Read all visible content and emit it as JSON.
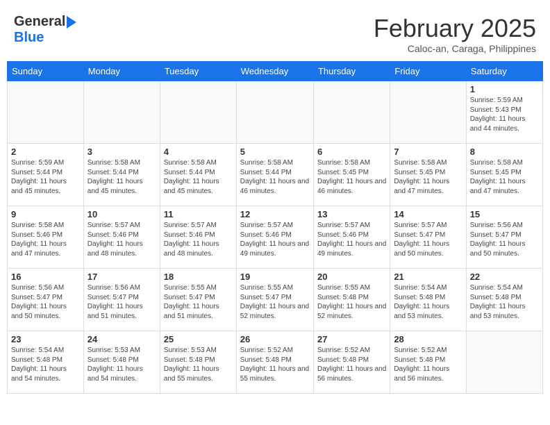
{
  "header": {
    "logo_general": "General",
    "logo_blue": "Blue",
    "month_title": "February 2025",
    "location": "Caloc-an, Caraga, Philippines"
  },
  "days_of_week": [
    "Sunday",
    "Monday",
    "Tuesday",
    "Wednesday",
    "Thursday",
    "Friday",
    "Saturday"
  ],
  "weeks": [
    [
      {
        "day": "",
        "info": ""
      },
      {
        "day": "",
        "info": ""
      },
      {
        "day": "",
        "info": ""
      },
      {
        "day": "",
        "info": ""
      },
      {
        "day": "",
        "info": ""
      },
      {
        "day": "",
        "info": ""
      },
      {
        "day": "1",
        "info": "Sunrise: 5:59 AM\nSunset: 5:43 PM\nDaylight: 11 hours\nand 44 minutes."
      }
    ],
    [
      {
        "day": "2",
        "info": "Sunrise: 5:59 AM\nSunset: 5:44 PM\nDaylight: 11 hours\nand 45 minutes."
      },
      {
        "day": "3",
        "info": "Sunrise: 5:58 AM\nSunset: 5:44 PM\nDaylight: 11 hours\nand 45 minutes."
      },
      {
        "day": "4",
        "info": "Sunrise: 5:58 AM\nSunset: 5:44 PM\nDaylight: 11 hours\nand 45 minutes."
      },
      {
        "day": "5",
        "info": "Sunrise: 5:58 AM\nSunset: 5:44 PM\nDaylight: 11 hours\nand 46 minutes."
      },
      {
        "day": "6",
        "info": "Sunrise: 5:58 AM\nSunset: 5:45 PM\nDaylight: 11 hours\nand 46 minutes."
      },
      {
        "day": "7",
        "info": "Sunrise: 5:58 AM\nSunset: 5:45 PM\nDaylight: 11 hours\nand 47 minutes."
      },
      {
        "day": "8",
        "info": "Sunrise: 5:58 AM\nSunset: 5:45 PM\nDaylight: 11 hours\nand 47 minutes."
      }
    ],
    [
      {
        "day": "9",
        "info": "Sunrise: 5:58 AM\nSunset: 5:46 PM\nDaylight: 11 hours\nand 47 minutes."
      },
      {
        "day": "10",
        "info": "Sunrise: 5:57 AM\nSunset: 5:46 PM\nDaylight: 11 hours\nand 48 minutes."
      },
      {
        "day": "11",
        "info": "Sunrise: 5:57 AM\nSunset: 5:46 PM\nDaylight: 11 hours\nand 48 minutes."
      },
      {
        "day": "12",
        "info": "Sunrise: 5:57 AM\nSunset: 5:46 PM\nDaylight: 11 hours\nand 49 minutes."
      },
      {
        "day": "13",
        "info": "Sunrise: 5:57 AM\nSunset: 5:46 PM\nDaylight: 11 hours\nand 49 minutes."
      },
      {
        "day": "14",
        "info": "Sunrise: 5:57 AM\nSunset: 5:47 PM\nDaylight: 11 hours\nand 50 minutes."
      },
      {
        "day": "15",
        "info": "Sunrise: 5:56 AM\nSunset: 5:47 PM\nDaylight: 11 hours\nand 50 minutes."
      }
    ],
    [
      {
        "day": "16",
        "info": "Sunrise: 5:56 AM\nSunset: 5:47 PM\nDaylight: 11 hours\nand 50 minutes."
      },
      {
        "day": "17",
        "info": "Sunrise: 5:56 AM\nSunset: 5:47 PM\nDaylight: 11 hours\nand 51 minutes."
      },
      {
        "day": "18",
        "info": "Sunrise: 5:55 AM\nSunset: 5:47 PM\nDaylight: 11 hours\nand 51 minutes."
      },
      {
        "day": "19",
        "info": "Sunrise: 5:55 AM\nSunset: 5:47 PM\nDaylight: 11 hours\nand 52 minutes."
      },
      {
        "day": "20",
        "info": "Sunrise: 5:55 AM\nSunset: 5:48 PM\nDaylight: 11 hours\nand 52 minutes."
      },
      {
        "day": "21",
        "info": "Sunrise: 5:54 AM\nSunset: 5:48 PM\nDaylight: 11 hours\nand 53 minutes."
      },
      {
        "day": "22",
        "info": "Sunrise: 5:54 AM\nSunset: 5:48 PM\nDaylight: 11 hours\nand 53 minutes."
      }
    ],
    [
      {
        "day": "23",
        "info": "Sunrise: 5:54 AM\nSunset: 5:48 PM\nDaylight: 11 hours\nand 54 minutes."
      },
      {
        "day": "24",
        "info": "Sunrise: 5:53 AM\nSunset: 5:48 PM\nDaylight: 11 hours\nand 54 minutes."
      },
      {
        "day": "25",
        "info": "Sunrise: 5:53 AM\nSunset: 5:48 PM\nDaylight: 11 hours\nand 55 minutes."
      },
      {
        "day": "26",
        "info": "Sunrise: 5:52 AM\nSunset: 5:48 PM\nDaylight: 11 hours\nand 55 minutes."
      },
      {
        "day": "27",
        "info": "Sunrise: 5:52 AM\nSunset: 5:48 PM\nDaylight: 11 hours\nand 56 minutes."
      },
      {
        "day": "28",
        "info": "Sunrise: 5:52 AM\nSunset: 5:48 PM\nDaylight: 11 hours\nand 56 minutes."
      },
      {
        "day": "",
        "info": ""
      }
    ]
  ]
}
